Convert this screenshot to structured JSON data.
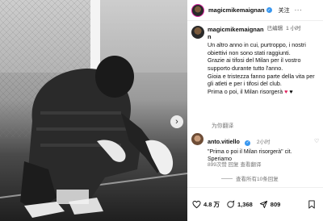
{
  "post": {
    "username": "magicmikemaignan",
    "follow_label": "关注",
    "more_label": "···",
    "next_arrow": "›",
    "caption": {
      "username_line1": "magicmikemaignan",
      "username_line2": "n",
      "edited": "已编辑",
      "time": "1 小时",
      "text": "Un altro anno in cui, purtroppo, i nostri obiettivi non sono stati raggiunti.\nGrazie ai tifosi del Milan per il vostro supporto durante tutto l'anno.\nGioia e tristezza fanno parte della vita per gli atleti e per i tifosi del club.\nPrima o poi, il Milan risorgerà",
      "emoji_red": "♥",
      "emoji_black": "♥"
    },
    "translate_label": "为你翻译"
  },
  "comment": {
    "username": "anto.vitiello",
    "time": "2小时",
    "text": "\"Prima o poi il Milan risorgerà\" cit. Speriamo",
    "meta": "899次赞  回复  查看翻译",
    "replies_label": "查看所有10条回复"
  },
  "actions": {
    "likes": "4.8 万",
    "comments": "1,368",
    "shares": "809"
  },
  "colors": {
    "verified": "#3897f0",
    "story_ring": "#d6249f",
    "heart_red": "#e0245e"
  },
  "icons": [
    "chevron-right-icon",
    "verified-icon",
    "heart-icon",
    "comment-icon",
    "share-icon",
    "bookmark-icon"
  ]
}
